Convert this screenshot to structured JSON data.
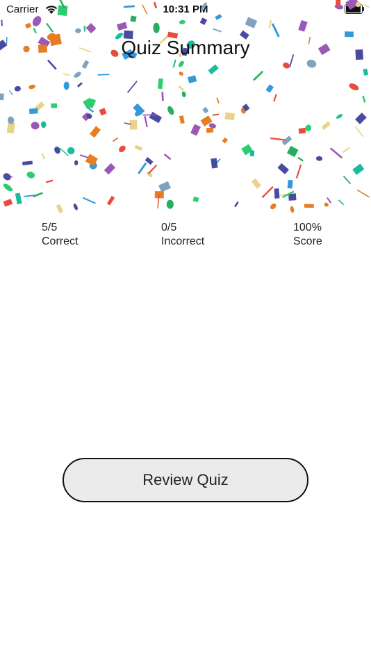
{
  "status_bar": {
    "carrier": "Carrier",
    "time": "10:31 PM",
    "battery_level": 0.95
  },
  "title": "Quiz Summary",
  "stats": [
    {
      "value": "5/5",
      "label": "Correct"
    },
    {
      "value": "0/5",
      "label": "Incorrect"
    },
    {
      "value": "100%",
      "label": "Score"
    }
  ],
  "review_button": {
    "label": "Review Quiz"
  },
  "confetti_colors": [
    "#2ecc71",
    "#e67e22",
    "#3498db",
    "#9b59b6",
    "#e8d48a",
    "#e74c3c",
    "#4a4aa0",
    "#7fa3bf",
    "#27ae60",
    "#1abc9c"
  ]
}
